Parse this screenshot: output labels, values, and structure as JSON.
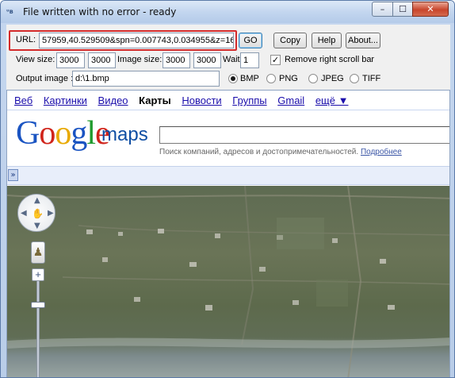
{
  "window": {
    "title": "File written with no error - ready",
    "app_icon": "ᵘʙ",
    "buttons": {
      "minimize": "–",
      "maximize": "☐",
      "close": "✕"
    }
  },
  "toolbar": {
    "url_label": "URL:",
    "url_value": "57959,40.529509&spn=0.007743,0.034955&z=16",
    "go_label": "GO",
    "copy_label": "Copy",
    "help_label": "Help",
    "about_label": "About...",
    "view_size_label": "View size:",
    "view_w": "3000",
    "view_h": "3000",
    "image_size_label": "Image size:",
    "image_w": "3000",
    "image_h": "3000",
    "wait_label": "Wait:",
    "wait_value": "1",
    "remove_scroll_label": "Remove right scroll bar",
    "remove_scroll_checked": "✓",
    "output_label": "Output image :",
    "output_value": "d:\\1.bmp",
    "formats": [
      "BMP",
      "PNG",
      "JPEG",
      "TIFF"
    ],
    "selected_format": "BMP"
  },
  "google": {
    "nav": [
      "Веб",
      "Картинки",
      "Видео",
      "Карты",
      "Новости",
      "Группы",
      "Gmail",
      "ещё ▼"
    ],
    "nav_active": "Карты",
    "logo_letters": [
      {
        "ch": "G",
        "color": "#1a54c2"
      },
      {
        "ch": "o",
        "color": "#d0241b"
      },
      {
        "ch": "o",
        "color": "#e8a900"
      },
      {
        "ch": "g",
        "color": "#1a54c2"
      },
      {
        "ch": "l",
        "color": "#1f9a2d"
      },
      {
        "ch": "e",
        "color": "#d0241b"
      }
    ],
    "logo_suffix": "maps",
    "search_value": "",
    "hint_text": "Поиск компаний, адресов и достопримечательностей.",
    "hint_link": "Подробнее",
    "expand_label": "»"
  },
  "map_controls": {
    "pan_up": "▲",
    "pan_down": "▼",
    "pan_left": "◀",
    "pan_right": "▶",
    "pan_center": "✋",
    "pegman": "♟",
    "zoom_in": "+"
  }
}
